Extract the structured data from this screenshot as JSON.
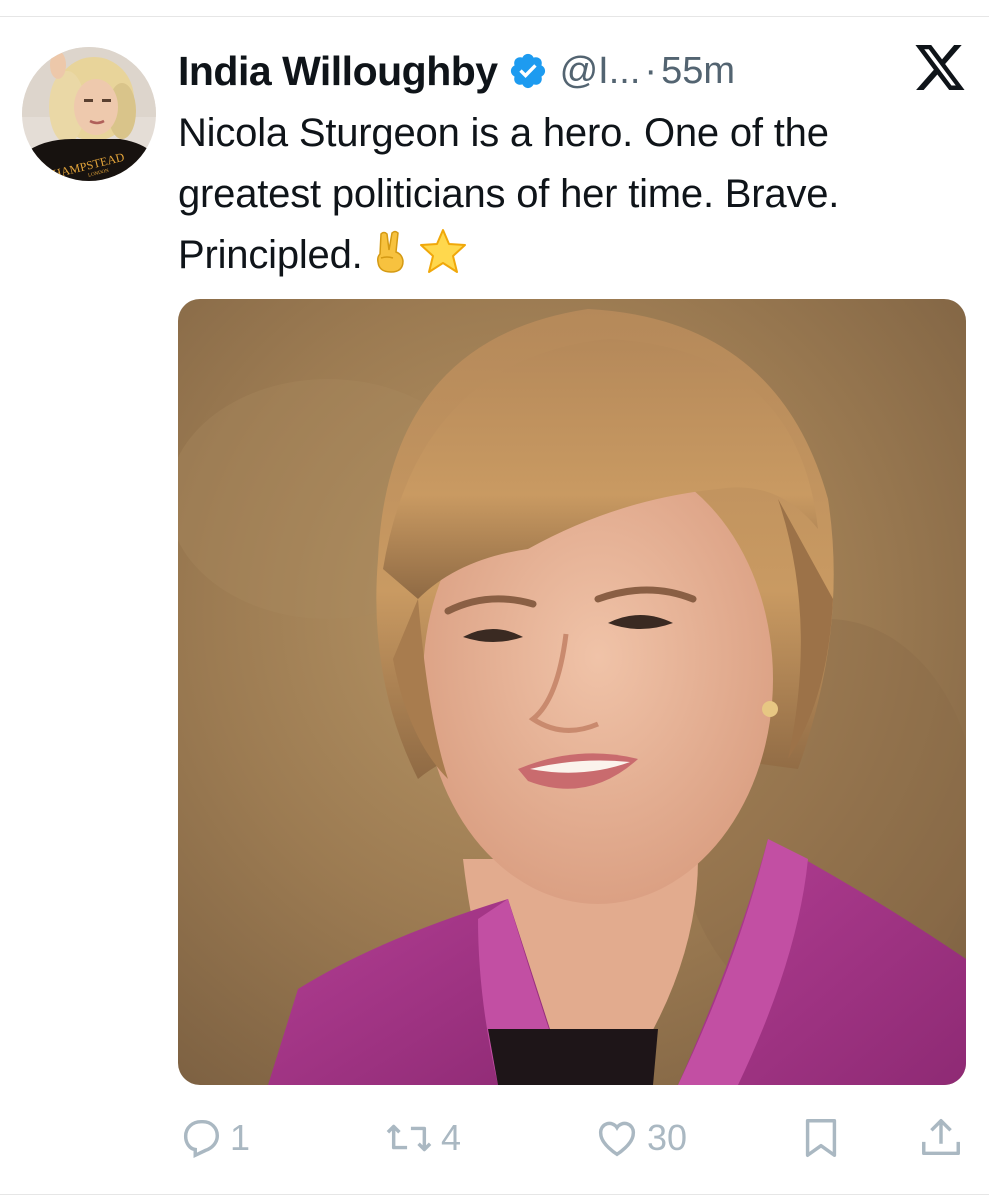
{
  "tweet": {
    "author_name": "India Willoughby",
    "handle": "@I...",
    "separator": "·",
    "time": "55m",
    "text_line1": "Nicola Sturgeon is a hero. One of the",
    "text_line2": "greatest politicians of her time. Brave.",
    "text_line3": "Principled.",
    "emojis": [
      "✌️",
      "⭐"
    ]
  },
  "avatar": {
    "shirt_text": "HAMPSTEAD",
    "shirt_subtext": "LONDON"
  },
  "actions": {
    "reply_count": "1",
    "retweet_count": "4",
    "like_count": "30"
  },
  "icons": {
    "verified": "verified-badge-icon",
    "brand": "x-logo-icon",
    "reply": "reply-icon",
    "retweet": "retweet-icon",
    "like": "heart-icon",
    "bookmark": "bookmark-icon",
    "share": "share-icon"
  },
  "colors": {
    "verified_blue": "#1d9bf0",
    "muted_text": "#536471",
    "action_gray": "#aab8c2",
    "jacket_magenta": "#a0307f"
  }
}
